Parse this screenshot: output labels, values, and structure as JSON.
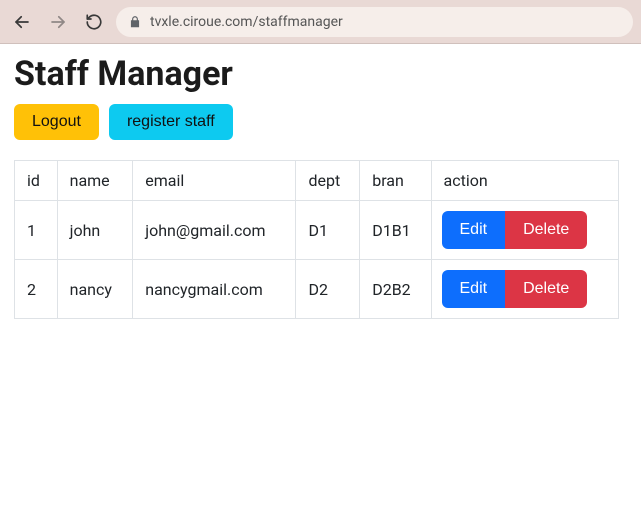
{
  "browser": {
    "url": "tvxle.ciroue.com/staffmanager"
  },
  "page": {
    "title": "Staff Manager"
  },
  "buttons": {
    "logout": "Logout",
    "register": "register staff",
    "edit": "Edit",
    "delete": "Delete"
  },
  "table": {
    "headers": {
      "id": "id",
      "name": "name",
      "email": "email",
      "dept": "dept",
      "bran": "bran",
      "action": "action"
    },
    "rows": [
      {
        "id": "1",
        "name": "john",
        "email": "john@gmail.com",
        "dept": "D1",
        "bran": "D1B1"
      },
      {
        "id": "2",
        "name": "nancy",
        "email": "nancygmail.com",
        "dept": "D2",
        "bran": "D2B2"
      }
    ]
  }
}
